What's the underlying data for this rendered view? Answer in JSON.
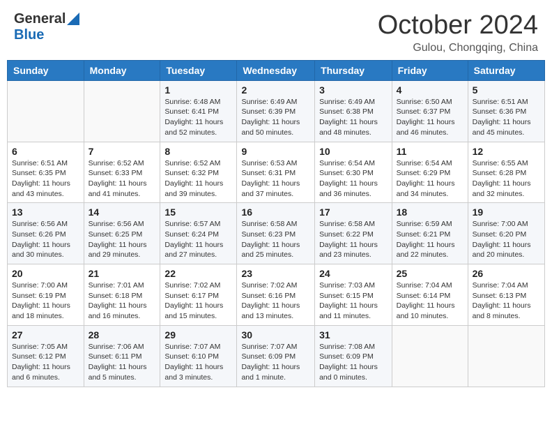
{
  "header": {
    "logo_general": "General",
    "logo_blue": "Blue",
    "month_title": "October 2024",
    "location": "Gulou, Chongqing, China"
  },
  "weekdays": [
    "Sunday",
    "Monday",
    "Tuesday",
    "Wednesday",
    "Thursday",
    "Friday",
    "Saturday"
  ],
  "weeks": [
    [
      {
        "day": "",
        "sunrise": "",
        "sunset": "",
        "daylight": ""
      },
      {
        "day": "",
        "sunrise": "",
        "sunset": "",
        "daylight": ""
      },
      {
        "day": "1",
        "sunrise": "Sunrise: 6:48 AM",
        "sunset": "Sunset: 6:41 PM",
        "daylight": "Daylight: 11 hours and 52 minutes."
      },
      {
        "day": "2",
        "sunrise": "Sunrise: 6:49 AM",
        "sunset": "Sunset: 6:39 PM",
        "daylight": "Daylight: 11 hours and 50 minutes."
      },
      {
        "day": "3",
        "sunrise": "Sunrise: 6:49 AM",
        "sunset": "Sunset: 6:38 PM",
        "daylight": "Daylight: 11 hours and 48 minutes."
      },
      {
        "day": "4",
        "sunrise": "Sunrise: 6:50 AM",
        "sunset": "Sunset: 6:37 PM",
        "daylight": "Daylight: 11 hours and 46 minutes."
      },
      {
        "day": "5",
        "sunrise": "Sunrise: 6:51 AM",
        "sunset": "Sunset: 6:36 PM",
        "daylight": "Daylight: 11 hours and 45 minutes."
      }
    ],
    [
      {
        "day": "6",
        "sunrise": "Sunrise: 6:51 AM",
        "sunset": "Sunset: 6:35 PM",
        "daylight": "Daylight: 11 hours and 43 minutes."
      },
      {
        "day": "7",
        "sunrise": "Sunrise: 6:52 AM",
        "sunset": "Sunset: 6:33 PM",
        "daylight": "Daylight: 11 hours and 41 minutes."
      },
      {
        "day": "8",
        "sunrise": "Sunrise: 6:52 AM",
        "sunset": "Sunset: 6:32 PM",
        "daylight": "Daylight: 11 hours and 39 minutes."
      },
      {
        "day": "9",
        "sunrise": "Sunrise: 6:53 AM",
        "sunset": "Sunset: 6:31 PM",
        "daylight": "Daylight: 11 hours and 37 minutes."
      },
      {
        "day": "10",
        "sunrise": "Sunrise: 6:54 AM",
        "sunset": "Sunset: 6:30 PM",
        "daylight": "Daylight: 11 hours and 36 minutes."
      },
      {
        "day": "11",
        "sunrise": "Sunrise: 6:54 AM",
        "sunset": "Sunset: 6:29 PM",
        "daylight": "Daylight: 11 hours and 34 minutes."
      },
      {
        "day": "12",
        "sunrise": "Sunrise: 6:55 AM",
        "sunset": "Sunset: 6:28 PM",
        "daylight": "Daylight: 11 hours and 32 minutes."
      }
    ],
    [
      {
        "day": "13",
        "sunrise": "Sunrise: 6:56 AM",
        "sunset": "Sunset: 6:26 PM",
        "daylight": "Daylight: 11 hours and 30 minutes."
      },
      {
        "day": "14",
        "sunrise": "Sunrise: 6:56 AM",
        "sunset": "Sunset: 6:25 PM",
        "daylight": "Daylight: 11 hours and 29 minutes."
      },
      {
        "day": "15",
        "sunrise": "Sunrise: 6:57 AM",
        "sunset": "Sunset: 6:24 PM",
        "daylight": "Daylight: 11 hours and 27 minutes."
      },
      {
        "day": "16",
        "sunrise": "Sunrise: 6:58 AM",
        "sunset": "Sunset: 6:23 PM",
        "daylight": "Daylight: 11 hours and 25 minutes."
      },
      {
        "day": "17",
        "sunrise": "Sunrise: 6:58 AM",
        "sunset": "Sunset: 6:22 PM",
        "daylight": "Daylight: 11 hours and 23 minutes."
      },
      {
        "day": "18",
        "sunrise": "Sunrise: 6:59 AM",
        "sunset": "Sunset: 6:21 PM",
        "daylight": "Daylight: 11 hours and 22 minutes."
      },
      {
        "day": "19",
        "sunrise": "Sunrise: 7:00 AM",
        "sunset": "Sunset: 6:20 PM",
        "daylight": "Daylight: 11 hours and 20 minutes."
      }
    ],
    [
      {
        "day": "20",
        "sunrise": "Sunrise: 7:00 AM",
        "sunset": "Sunset: 6:19 PM",
        "daylight": "Daylight: 11 hours and 18 minutes."
      },
      {
        "day": "21",
        "sunrise": "Sunrise: 7:01 AM",
        "sunset": "Sunset: 6:18 PM",
        "daylight": "Daylight: 11 hours and 16 minutes."
      },
      {
        "day": "22",
        "sunrise": "Sunrise: 7:02 AM",
        "sunset": "Sunset: 6:17 PM",
        "daylight": "Daylight: 11 hours and 15 minutes."
      },
      {
        "day": "23",
        "sunrise": "Sunrise: 7:02 AM",
        "sunset": "Sunset: 6:16 PM",
        "daylight": "Daylight: 11 hours and 13 minutes."
      },
      {
        "day": "24",
        "sunrise": "Sunrise: 7:03 AM",
        "sunset": "Sunset: 6:15 PM",
        "daylight": "Daylight: 11 hours and 11 minutes."
      },
      {
        "day": "25",
        "sunrise": "Sunrise: 7:04 AM",
        "sunset": "Sunset: 6:14 PM",
        "daylight": "Daylight: 11 hours and 10 minutes."
      },
      {
        "day": "26",
        "sunrise": "Sunrise: 7:04 AM",
        "sunset": "Sunset: 6:13 PM",
        "daylight": "Daylight: 11 hours and 8 minutes."
      }
    ],
    [
      {
        "day": "27",
        "sunrise": "Sunrise: 7:05 AM",
        "sunset": "Sunset: 6:12 PM",
        "daylight": "Daylight: 11 hours and 6 minutes."
      },
      {
        "day": "28",
        "sunrise": "Sunrise: 7:06 AM",
        "sunset": "Sunset: 6:11 PM",
        "daylight": "Daylight: 11 hours and 5 minutes."
      },
      {
        "day": "29",
        "sunrise": "Sunrise: 7:07 AM",
        "sunset": "Sunset: 6:10 PM",
        "daylight": "Daylight: 11 hours and 3 minutes."
      },
      {
        "day": "30",
        "sunrise": "Sunrise: 7:07 AM",
        "sunset": "Sunset: 6:09 PM",
        "daylight": "Daylight: 11 hours and 1 minute."
      },
      {
        "day": "31",
        "sunrise": "Sunrise: 7:08 AM",
        "sunset": "Sunset: 6:09 PM",
        "daylight": "Daylight: 11 hours and 0 minutes."
      },
      {
        "day": "",
        "sunrise": "",
        "sunset": "",
        "daylight": ""
      },
      {
        "day": "",
        "sunrise": "",
        "sunset": "",
        "daylight": ""
      }
    ]
  ]
}
